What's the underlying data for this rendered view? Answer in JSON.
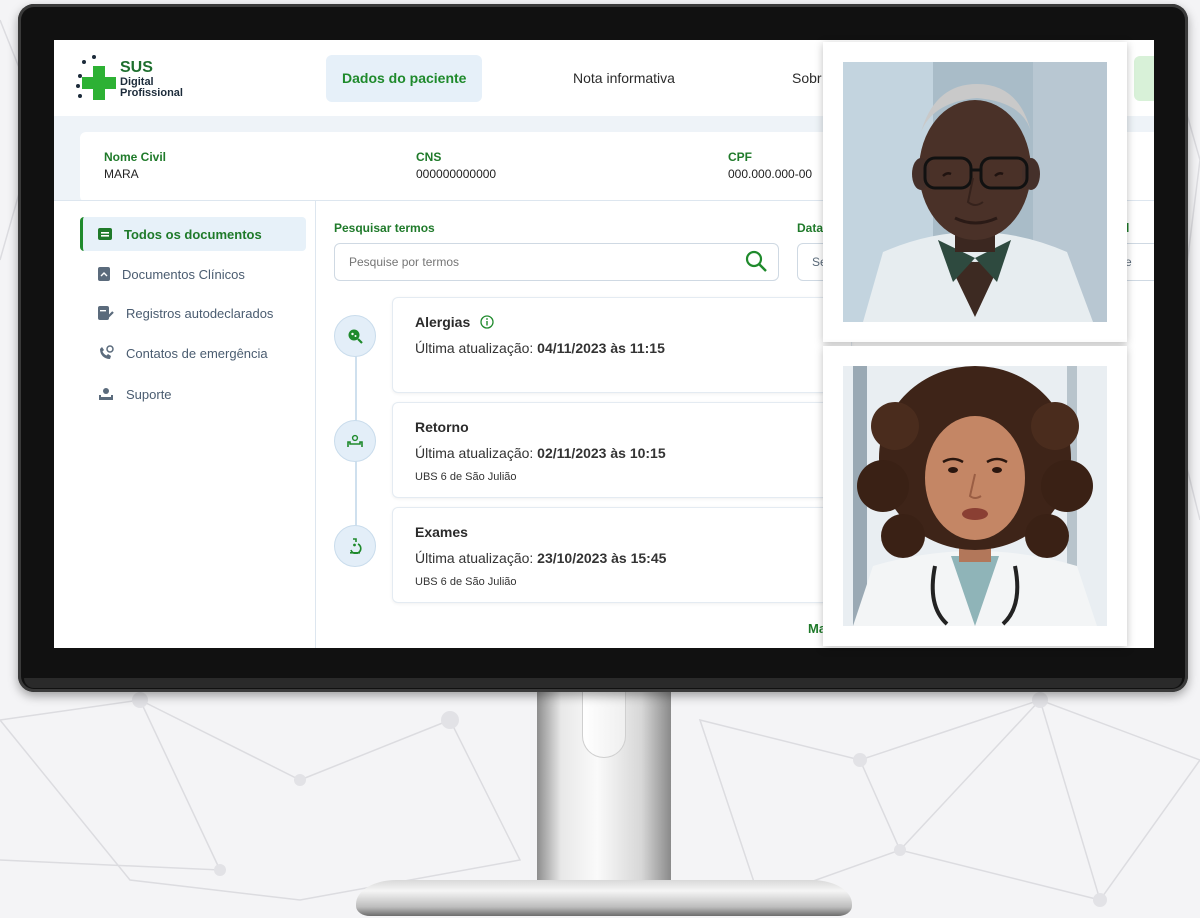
{
  "app": {
    "logo_title": "SUS",
    "logo_line1": "Digital",
    "logo_line2": "Profissional"
  },
  "nav": {
    "tabs": [
      {
        "label": "Dados do paciente",
        "active": true
      },
      {
        "label": "Nota informativa",
        "active": false
      },
      {
        "label": "Sobr",
        "active": false
      }
    ]
  },
  "patient": {
    "name_label": "Nome Civil",
    "name_value": "MARA",
    "cns_label": "CNS",
    "cns_value": "000000000000",
    "cpf_label": "CPF",
    "cpf_value": "000.000.000-00"
  },
  "sidebar": {
    "items": [
      {
        "label": "Todos os documentos",
        "icon": "documents-icon",
        "active": true
      },
      {
        "label": "Documentos Clínicos",
        "icon": "clinical-document-icon",
        "active": false
      },
      {
        "label": "Registros autodeclarados",
        "icon": "self-declared-icon",
        "active": false
      },
      {
        "label": "Contatos de emergência",
        "icon": "emergency-phone-icon",
        "active": false
      },
      {
        "label": "Suporte",
        "icon": "support-icon",
        "active": false
      }
    ]
  },
  "filters": {
    "search_label": "Pesquisar termos",
    "search_placeholder": "Pesquise por termos",
    "date_label": "Data",
    "date_value": "Se",
    "right_label": "l",
    "right_value": "ione"
  },
  "documents": [
    {
      "title": "Alergias",
      "updated_prefix": "Última atualização: ",
      "updated_value": "04/11/2023 às 11:15",
      "location": "",
      "icon": "allergy-icon"
    },
    {
      "title": "Retorno",
      "updated_prefix": "Última atualização: ",
      "updated_value": "02/11/2023 às 10:15",
      "location": "UBS 6 de São Julião",
      "icon": "bed-icon"
    },
    {
      "title": "Exames",
      "updated_prefix": "Última atualização: ",
      "updated_value": "23/10/2023 às 15:45",
      "location": "UBS 6 de São Julião",
      "icon": "microscope-icon"
    }
  ],
  "more_link": "Ma",
  "colors": {
    "brand_green": "#2db134",
    "text_green": "#1f7a2a",
    "active_bg": "#e6f0f9"
  }
}
